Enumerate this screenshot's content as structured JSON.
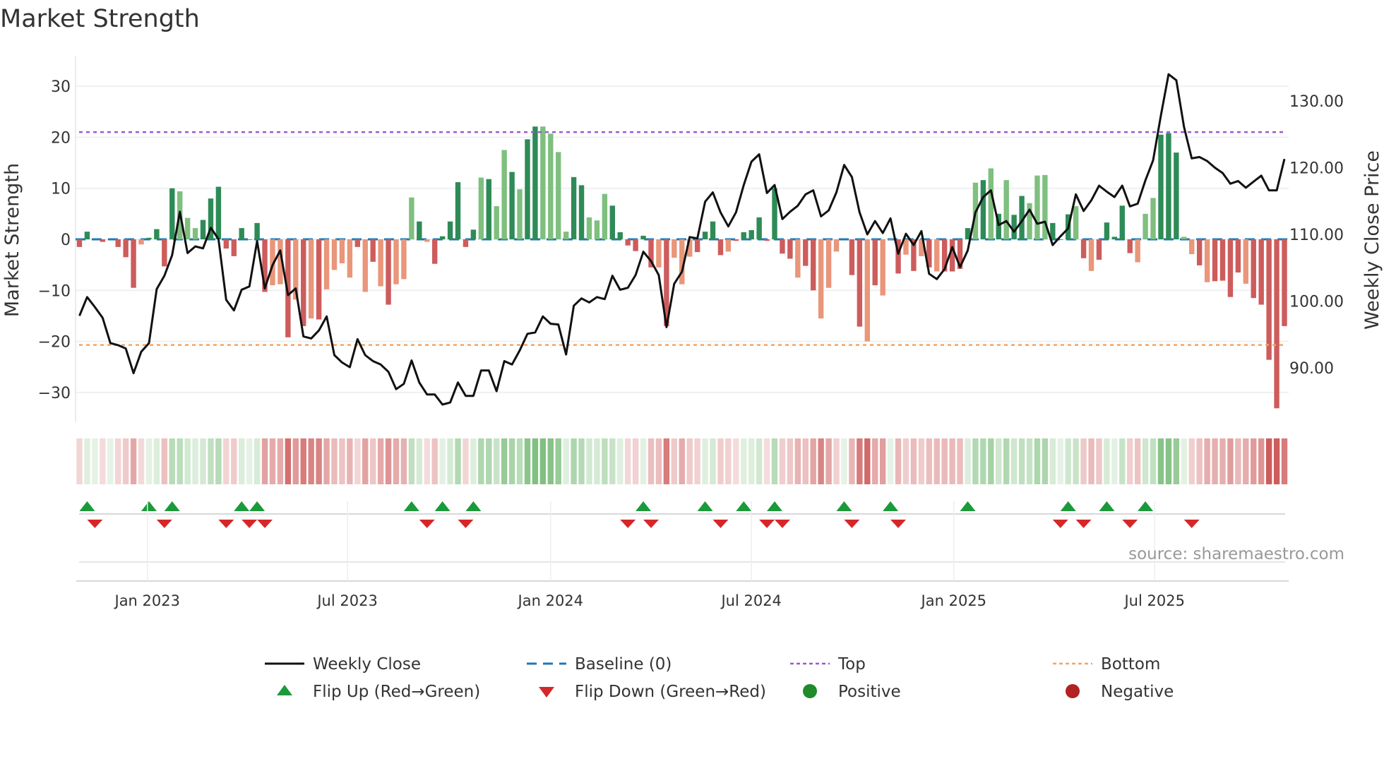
{
  "chart_data": {
    "type": "bar",
    "title": "Market Strength",
    "ylabel": "Market Strength",
    "y2label": "Weekly Close Price",
    "ylim": [
      -36,
      36
    ],
    "y2lim": [
      82.7,
      137
    ],
    "yticks": [
      30,
      20,
      10,
      0,
      -10,
      -20,
      -30
    ],
    "yticklabels": [
      "30",
      "20",
      "10",
      "0",
      "−10",
      "−20",
      "−30"
    ],
    "y2ticks": [
      130,
      120,
      110,
      100,
      90
    ],
    "y2ticklabels": [
      "130.00",
      "120.00",
      "110.00",
      "100.00",
      "90.00"
    ],
    "top_level": 21,
    "bottom_level": -20.7,
    "baseline": 0,
    "xticks": [
      {
        "label": "Jan 2023",
        "week": 8.8
      },
      {
        "label": "Jul 2023",
        "week": 34.7
      },
      {
        "label": "Jan 2024",
        "week": 61
      },
      {
        "label": "Jul 2024",
        "week": 87
      },
      {
        "label": "Jan 2025",
        "week": 113.2
      },
      {
        "label": "Jul 2025",
        "week": 139.2
      }
    ],
    "strength": [
      -1.5,
      1.5,
      0,
      -0.5,
      0,
      -1.5,
      -3.5,
      -9.5,
      -1,
      0.3,
      2,
      -5.3,
      10,
      9.4,
      4.2,
      2.2,
      3.8,
      8,
      10.3,
      -1.8,
      -3.3,
      2.2,
      0,
      3.2,
      -10.3,
      -9,
      -8.8,
      -19.2,
      -11.8,
      -17,
      -15.5,
      -15.7,
      -9.8,
      -6,
      -4.7,
      -7.5,
      -1.5,
      -10.3,
      -4.4,
      -9.2,
      -12.8,
      -8.8,
      -7.8,
      8.2,
      3.5,
      -0.5,
      -4.8,
      0.6,
      3.5,
      11.2,
      -1.5,
      1.9,
      12.1,
      11.8,
      6.5,
      17.5,
      13.2,
      9.8,
      19.6,
      22.1,
      22.1,
      20.7,
      17.1,
      1.5,
      12.2,
      10.6,
      4.3,
      3.7,
      8.9,
      6.6,
      1.4,
      -1.2,
      -2.3,
      0.7,
      -5.5,
      -5.5,
      -17,
      -3.6,
      -8.8,
      -3.4,
      -2.5,
      1.5,
      3.5,
      -3.1,
      -2.4,
      -0.3,
      1.4,
      1.8,
      4.3,
      -0.3,
      10,
      -2.8,
      -3.8,
      -7.5,
      -5.2,
      -10,
      -15.5,
      -9.5,
      -2.4,
      0,
      -7,
      -17.1,
      -20,
      -9,
      -11,
      0,
      -6.7,
      -3,
      -6.2,
      -3.3,
      -5.5,
      -6.3,
      -6.3,
      -6.3,
      -5.8,
      2.2,
      11.1,
      11.6,
      13.9,
      5,
      11.6,
      4.8,
      8.5,
      7.1,
      12.5,
      12.6,
      3.2,
      0,
      4.9,
      6.5,
      -3.7,
      -6.2,
      -4,
      3.3,
      0.5,
      6.6,
      -2.7,
      -4.5,
      5,
      8.1,
      20.5,
      20.8,
      17,
      0.5,
      -2.9,
      -5.1,
      -8.4,
      -8.2,
      -8.1,
      -11.3,
      -6.5,
      -8.7,
      -11.5,
      -12.8,
      -23.6,
      -33.1,
      -17
    ],
    "shade": "rdrrrrrrld drdllldddr rdrdrllrlr lrllllrlrl rllldlrddd rdldlldldd llllddlllr rdrrrlrllldd rrldddrdrr rlrrlllrrr lrllrlrlrl ddddld ldlddllldrr ldlrrdddlll rrrllrlrrrrl",
    "weekly_close": [
      97.8,
      100.6,
      99.1,
      97.5,
      93.7,
      93.4,
      92.9,
      89.2,
      92.4,
      93.7,
      101.8,
      103.8,
      106.9,
      113.4,
      107.2,
      108.2,
      107.9,
      111.0,
      109.3,
      100.2,
      98.6,
      101.7,
      102.2,
      109.0,
      101.9,
      105.4,
      107.6,
      100.9,
      101.9,
      94.7,
      94.4,
      95.6,
      97.7,
      91.9,
      90.8,
      90.1,
      94.3,
      91.9,
      91.0,
      90.5,
      89.4,
      86.8,
      87.6,
      91.1,
      87.8,
      86.0,
      86.0,
      84.5,
      84.8,
      87.8,
      85.8,
      85.8,
      89.6,
      89.6,
      86.5,
      91.0,
      90.5,
      92.6,
      95.1,
      95.3,
      97.7,
      96.6,
      96.5,
      92.0,
      99.3,
      100.4,
      99.8,
      100.6,
      100.3,
      103.8,
      101.7,
      102.0,
      103.9,
      107.4,
      106.0,
      103.9,
      96.1,
      102.6,
      104.4,
      109.6,
      109.4,
      114.9,
      116.3,
      113.3,
      111.2,
      113.3,
      117.4,
      120.9,
      122.0,
      116.2,
      117.4,
      112.3,
      113.4,
      114.3,
      116.0,
      116.6,
      112.7,
      113.6,
      116.3,
      120.4,
      118.6,
      113.3,
      110.0,
      112.0,
      110.2,
      112.4,
      107.1,
      110.1,
      108.4,
      110.5,
      104.1,
      103.3,
      104.8,
      108.1,
      105.1,
      107.6,
      113.3,
      115.6,
      116.6,
      111.4,
      112.0,
      110.4,
      112.0,
      113.7,
      111.6,
      111.9,
      108.4,
      109.7,
      110.9,
      116.0,
      113.5,
      115.1,
      117.3,
      116.4,
      115.6,
      117.3,
      114.2,
      114.6,
      118.1,
      121.1,
      127.8,
      134.0,
      133.1,
      126.1,
      121.4,
      121.6,
      121.0,
      120.0,
      119.2,
      117.6,
      118.0,
      117.0,
      117.9,
      118.8,
      116.6,
      116.6,
      121.3
    ],
    "flip_up_weeks": [
      1,
      9,
      12,
      21,
      23,
      43,
      47,
      51,
      73,
      81,
      86,
      90,
      99,
      105,
      115,
      128,
      133,
      138
    ],
    "flip_down_weeks": [
      2,
      11,
      19,
      22,
      24,
      45,
      50,
      71,
      74,
      83,
      89,
      91,
      100,
      106,
      127,
      130,
      136,
      144
    ],
    "legend": [
      {
        "label": "Weekly Close",
        "symbol": "line"
      },
      {
        "label": "Baseline (0)",
        "symbol": "dash"
      },
      {
        "label": "Top",
        "symbol": "dot-purple"
      },
      {
        "label": "Bottom",
        "symbol": "dot-orange"
      },
      {
        "label": "Flip Up (Red→Green)",
        "symbol": "triangle-up"
      },
      {
        "label": "Flip Down (Green→Red)",
        "symbol": "triangle-down"
      },
      {
        "label": "Positive",
        "symbol": "circle-green"
      },
      {
        "label": "Negative",
        "symbol": "circle-red"
      }
    ],
    "source": "source: sharemaestro.com",
    "colors": {
      "pos_dark": "#2e8b57",
      "pos_light": "#7fbf7f",
      "neg_dark": "#cd5c5c",
      "neg_light": "#e9967a",
      "price": "#111111",
      "baseline": "#1f77b4",
      "top": "#9b59d0",
      "bottom": "#f4a460",
      "up": "#1a9a3a",
      "down": "#d62728",
      "positive": "#1f8b2a",
      "negative": "#b22222"
    }
  }
}
